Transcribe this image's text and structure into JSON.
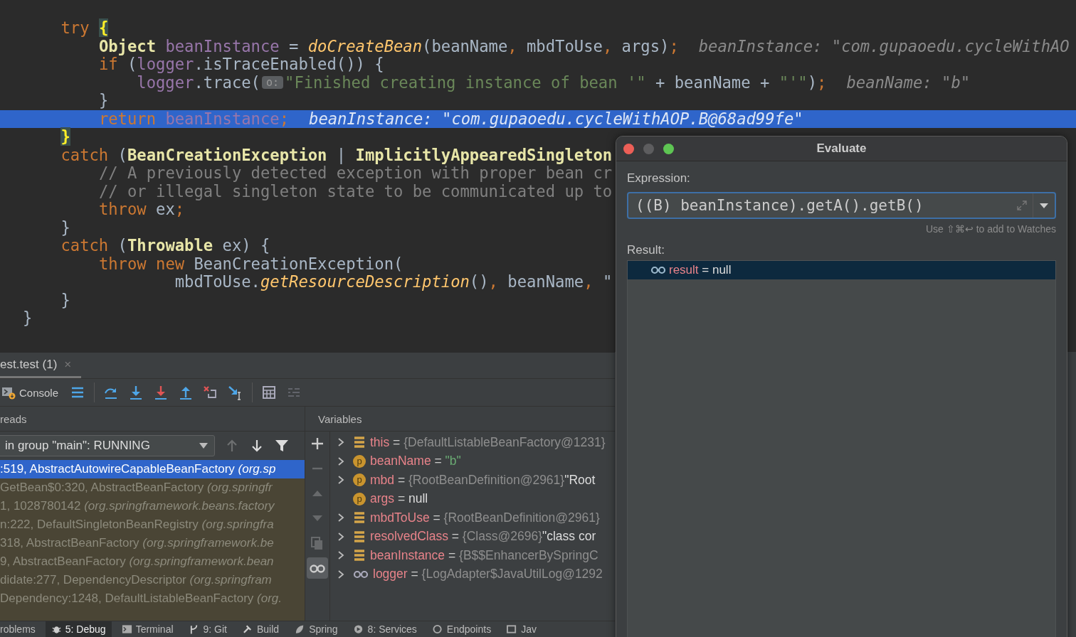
{
  "editor": {
    "lines": [
      {
        "current": false,
        "segments": [
          {
            "kind": "code",
            "tokens": [
              {
                "kind": "keyword",
                "text": "    try "
              },
              {
                "kind": "brace",
                "text": "{"
              }
            ]
          }
        ]
      },
      {
        "current": false,
        "segments": [
          {
            "kind": "code",
            "tokens": [
              {
                "kind": "type",
                "text": "        Object"
              },
              {
                "kind": "field",
                "text": " beanInstance"
              },
              {
                "kind": "plain",
                "text": " = "
              },
              {
                "kind": "method",
                "text": "doCreateBean"
              },
              {
                "kind": "plain",
                "text": "(beanName"
              },
              {
                "kind": "punct",
                "text": ","
              },
              {
                "kind": "plain",
                "text": " mbdToUse"
              },
              {
                "kind": "punct",
                "text": ","
              },
              {
                "kind": "plain",
                "text": " args)"
              },
              {
                "kind": "punct",
                "text": ";"
              }
            ]
          },
          {
            "kind": "inline-value",
            "text": "beanInstance: \"com.gupaoedu.cycleWithAO"
          }
        ]
      },
      {
        "current": false,
        "segments": [
          {
            "kind": "code",
            "tokens": [
              {
                "kind": "keyword",
                "text": "        if"
              },
              {
                "kind": "plain",
                "text": " ("
              },
              {
                "kind": "field",
                "text": "logger"
              },
              {
                "kind": "plain",
                "text": ".isTraceEnabled()) {"
              }
            ]
          }
        ]
      },
      {
        "current": false,
        "segments": [
          {
            "kind": "code",
            "tokens": [
              {
                "kind": "field",
                "text": "            logger"
              },
              {
                "kind": "plain",
                "text": ".trace("
              }
            ]
          },
          {
            "kind": "param-hint",
            "text": "o:"
          },
          {
            "kind": "code",
            "tokens": [
              {
                "kind": "string",
                "text": "\"Finished creating instance of bean '\""
              },
              {
                "kind": "plain",
                "text": " + beanName + "
              },
              {
                "kind": "string",
                "text": "\"'\""
              },
              {
                "kind": "plain",
                "text": ")"
              },
              {
                "kind": "punct",
                "text": ";"
              }
            ]
          },
          {
            "kind": "inline-value",
            "text": "beanName: \"b\""
          }
        ]
      },
      {
        "current": false,
        "segments": [
          {
            "kind": "code",
            "tokens": [
              {
                "kind": "plain",
                "text": "        }"
              }
            ]
          }
        ]
      },
      {
        "current": true,
        "segments": [
          {
            "kind": "code",
            "tokens": [
              {
                "kind": "keyword",
                "text": "        return"
              },
              {
                "kind": "field",
                "text": " beanInstance"
              },
              {
                "kind": "punct",
                "text": ";"
              }
            ]
          },
          {
            "kind": "inline-value",
            "text": "beanInstance: \"com.gupaoedu.cycleWithAOP.B@68ad99fe\""
          }
        ]
      },
      {
        "current": false,
        "segments": [
          {
            "kind": "code",
            "tokens": [
              {
                "kind": "brace",
                "text": "    }"
              }
            ]
          }
        ]
      },
      {
        "current": false,
        "segments": [
          {
            "kind": "code",
            "tokens": [
              {
                "kind": "keyword",
                "text": "    catch"
              },
              {
                "kind": "plain",
                "text": " ("
              },
              {
                "kind": "type",
                "text": "BeanCreationException"
              },
              {
                "kind": "plain",
                "text": " | "
              },
              {
                "kind": "type",
                "text": "ImplicitlyAppearedSingleton"
              }
            ]
          }
        ]
      },
      {
        "current": false,
        "segments": [
          {
            "kind": "code",
            "tokens": [
              {
                "kind": "comment",
                "text": "        // A previously detected exception with proper bean cr"
              }
            ]
          }
        ]
      },
      {
        "current": false,
        "segments": [
          {
            "kind": "code",
            "tokens": [
              {
                "kind": "comment",
                "text": "        // or illegal singleton state to be communicated up to"
              }
            ]
          }
        ]
      },
      {
        "current": false,
        "segments": [
          {
            "kind": "code",
            "tokens": [
              {
                "kind": "keyword",
                "text": "        throw"
              },
              {
                "kind": "plain",
                "text": " ex"
              },
              {
                "kind": "punct",
                "text": ";"
              }
            ]
          }
        ]
      },
      {
        "current": false,
        "segments": [
          {
            "kind": "code",
            "tokens": [
              {
                "kind": "plain",
                "text": "    }"
              }
            ]
          }
        ]
      },
      {
        "current": false,
        "segments": [
          {
            "kind": "code",
            "tokens": [
              {
                "kind": "keyword",
                "text": "    catch"
              },
              {
                "kind": "plain",
                "text": " ("
              },
              {
                "kind": "type",
                "text": "Throwable"
              },
              {
                "kind": "plain",
                "text": " ex) {"
              }
            ]
          }
        ]
      },
      {
        "current": false,
        "segments": [
          {
            "kind": "code",
            "tokens": [
              {
                "kind": "keyword",
                "text": "        throw new"
              },
              {
                "kind": "plain",
                "text": " BeanCreationException("
              }
            ]
          }
        ]
      },
      {
        "current": false,
        "segments": [
          {
            "kind": "code",
            "tokens": [
              {
                "kind": "plain",
                "text": "                mbdToUse."
              },
              {
                "kind": "method",
                "text": "getResourceDescription"
              },
              {
                "kind": "plain",
                "text": "()"
              },
              {
                "kind": "punct",
                "text": ","
              },
              {
                "kind": "plain",
                "text": " beanName"
              },
              {
                "kind": "punct",
                "text": ","
              },
              {
                "kind": "plain",
                "text": " \""
              }
            ]
          }
        ]
      },
      {
        "current": false,
        "segments": [
          {
            "kind": "code",
            "tokens": [
              {
                "kind": "plain",
                "text": "    }"
              }
            ]
          }
        ]
      },
      {
        "current": false,
        "segments": [
          {
            "kind": "code",
            "tokens": [
              {
                "kind": "plain",
                "text": "}"
              }
            ]
          }
        ]
      }
    ]
  },
  "debug": {
    "session_tab": {
      "label": "est.test (1)",
      "close": "×"
    },
    "toolbar": [
      {
        "kind": "console",
        "label": "Console",
        "disabled": false
      },
      {
        "kind": "list",
        "disabled": false
      },
      {
        "kind": "separator"
      },
      {
        "kind": "step-over",
        "disabled": false
      },
      {
        "kind": "step-into",
        "disabled": false
      },
      {
        "kind": "force-step-into",
        "disabled": false
      },
      {
        "kind": "step-out",
        "disabled": false
      },
      {
        "kind": "drop-frame",
        "disabled": false
      },
      {
        "kind": "run-to-cursor",
        "disabled": false
      },
      {
        "kind": "separator"
      },
      {
        "kind": "evaluate",
        "disabled": false
      },
      {
        "kind": "trace",
        "disabled": true
      }
    ],
    "frames": {
      "title": "reads",
      "thread": "in group \"main\": RUNNING",
      "nav": [
        {
          "kind": "up",
          "disabled": true
        },
        {
          "kind": "down",
          "disabled": false
        },
        {
          "kind": "filter",
          "disabled": false
        }
      ],
      "items": [
        {
          "method": ":519, AbstractAutowireCapableBeanFactory",
          "package": "(org.sp",
          "selected": true,
          "library": false
        },
        {
          "method": "GetBean$0:320, AbstractBeanFactory",
          "package": "(org.springfr",
          "selected": false,
          "library": true
        },
        {
          "method": "1, 1028780142",
          "package": "(org.springframework.beans.factory",
          "selected": false,
          "library": true
        },
        {
          "method": "n:222, DefaultSingletonBeanRegistry",
          "package": "(org.springfra",
          "selected": false,
          "library": true
        },
        {
          "method": "318, AbstractBeanFactory",
          "package": "(org.springframework.be",
          "selected": false,
          "library": true
        },
        {
          "method": "9, AbstractBeanFactory",
          "package": "(org.springframework.bean",
          "selected": false,
          "library": true
        },
        {
          "method": "didate:277, DependencyDescriptor",
          "package": "(org.springfram",
          "selected": false,
          "library": true
        },
        {
          "method": "Dependency:1248, DefaultListableBeanFactory",
          "package": "(org.",
          "selected": false,
          "library": true
        }
      ]
    },
    "variables": {
      "title": "Variables",
      "tools": [
        {
          "kind": "add",
          "disabled": false
        },
        {
          "kind": "remove",
          "disabled": true
        },
        {
          "kind": "move-up",
          "disabled": true
        },
        {
          "kind": "move-down",
          "disabled": true
        },
        {
          "kind": "copy",
          "disabled": true
        },
        {
          "kind": "watches",
          "disabled": false,
          "selected": true
        }
      ],
      "items": [
        {
          "kind": "field",
          "expandable": true,
          "name": "this",
          "operator": "=",
          "value": {
            "kind": "ref",
            "text": "{DefaultListableBeanFactory@1231}"
          }
        },
        {
          "kind": "param",
          "badge": "p",
          "expandable": true,
          "name": "beanName",
          "operator": "=",
          "value": {
            "kind": "string",
            "text": "\"b\""
          }
        },
        {
          "kind": "param",
          "badge": "p",
          "expandable": true,
          "name": "mbd",
          "operator": "=",
          "value": {
            "kind": "ref",
            "text": "{RootBeanDefinition@2961}"
          },
          "detail": "\"Root"
        },
        {
          "kind": "param",
          "badge": "p",
          "expandable": false,
          "name": "args",
          "operator": "=",
          "value": {
            "kind": "null",
            "text": "null"
          }
        },
        {
          "kind": "field",
          "expandable": true,
          "name": "mbdToUse",
          "operator": "=",
          "value": {
            "kind": "ref",
            "text": "{RootBeanDefinition@2961}"
          }
        },
        {
          "kind": "field",
          "expandable": true,
          "name": "resolvedClass",
          "operator": "=",
          "value": {
            "kind": "ref",
            "text": "{Class@2696}"
          },
          "detail": "\"class cor"
        },
        {
          "kind": "field",
          "expandable": true,
          "name": "beanInstance",
          "operator": "=",
          "value": {
            "kind": "ref",
            "text": "{B$$EnhancerBySpringC"
          }
        },
        {
          "kind": "watch",
          "expandable": true,
          "name": "logger",
          "operator": "=",
          "value": {
            "kind": "ref",
            "text": "{LogAdapter$JavaUtilLog@1292"
          }
        }
      ]
    }
  },
  "tool_tabs": [
    {
      "kind": "problems",
      "label": "roblems",
      "selected": false
    },
    {
      "kind": "debug",
      "label": "5: Debug",
      "selected": true
    },
    {
      "kind": "terminal",
      "label": "Terminal",
      "selected": false
    },
    {
      "kind": "git",
      "label": "9: Git",
      "selected": false
    },
    {
      "kind": "build",
      "label": "Build",
      "selected": false
    },
    {
      "kind": "spring",
      "label": "Spring",
      "selected": false
    },
    {
      "kind": "services",
      "label": "8: Services",
      "selected": false
    },
    {
      "kind": "endpoints",
      "label": "Endpoints",
      "selected": false
    },
    {
      "kind": "java",
      "label": "Jav",
      "selected": false
    }
  ],
  "evaluate_dialog": {
    "title": "Evaluate",
    "expression_label": "Expression:",
    "expression": "((B) beanInstance).getA().getB()",
    "hint": "Use ⇧⌘↩ to add to Watches",
    "result_label": "Result:",
    "results": [
      {
        "name": "result",
        "operator": "=",
        "value": "null",
        "selected": true
      }
    ]
  }
}
